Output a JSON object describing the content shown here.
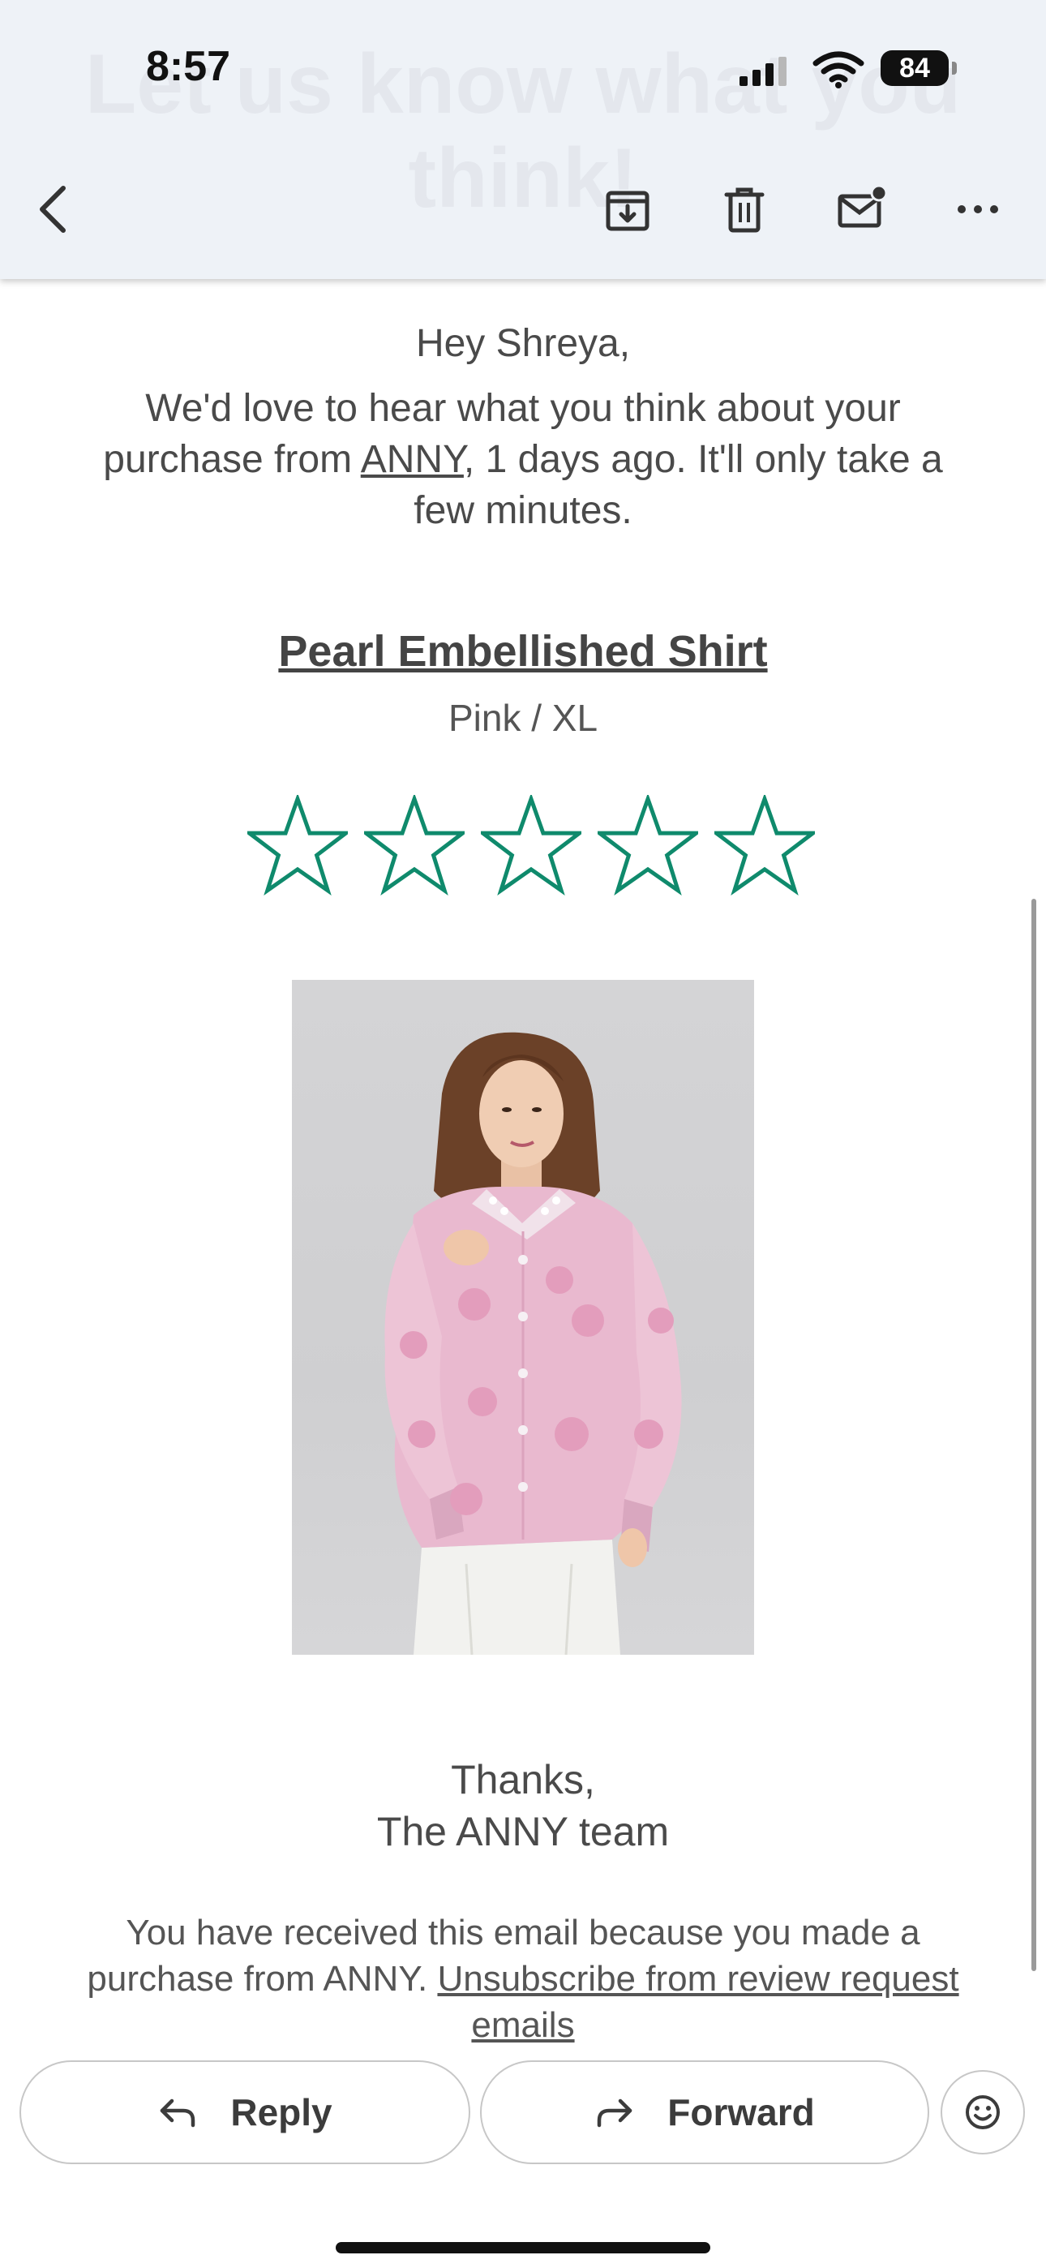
{
  "status_bar": {
    "time": "8:57",
    "battery": "84"
  },
  "header": {
    "ghost_title": "Let us know what you think!"
  },
  "email": {
    "greeting": "Hey Shreya,",
    "intro_before": "We'd love to hear what you think about your purchase from ",
    "brand_link": "ANNY",
    "intro_after": ", 1 days ago. It'll only take a few minutes.",
    "product_name": "Pearl Embellished Shirt",
    "variant": "Pink / XL",
    "rating": {
      "max_stars": 5,
      "selected": 0,
      "color": "#0f8a6c"
    },
    "signoff_line1": "Thanks,",
    "signoff_line2": "The ANNY team",
    "footer_text": "You have received this email because you made a purchase from ANNY. ",
    "unsubscribe_link": "Unsubscribe from review request emails"
  },
  "actions": {
    "reply": "Reply",
    "forward": "Forward"
  },
  "colors": {
    "topbar_bg": "#eef2f7",
    "accent_star": "#0f8a6c",
    "shirt_pink": "#e9b9cf"
  }
}
